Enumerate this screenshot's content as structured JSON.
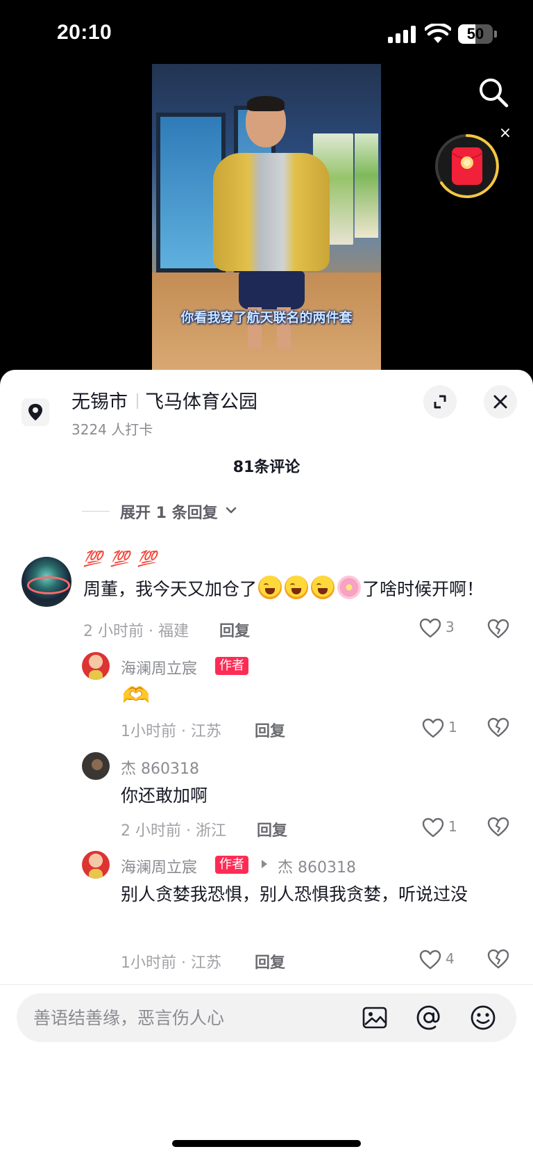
{
  "status_bar": {
    "time": "20:10",
    "battery": "50",
    "battery_level_percent": 50
  },
  "video": {
    "subtitle": "你看我穿了航天联名的两件套"
  },
  "location": {
    "city": "无锡市",
    "place": "飞马体育公园",
    "checkins": "3224 人打卡"
  },
  "comments_header": {
    "count_label": "81条评论"
  },
  "expand_replies": {
    "label": "展开 1 条回复"
  },
  "comments": [
    {
      "emoji_line": "💯 💯 💯",
      "text_before": "周董，我今天又加仓了",
      "text_after": "了啥时候开啊！",
      "meta": "2 小时前 · 福建",
      "reply_label": "回复",
      "likes": "3"
    }
  ],
  "replies": [
    {
      "author": "海澜周立宸",
      "badge": "作者",
      "text": "🫶",
      "meta": "1小时前 · 江苏",
      "reply_label": "回复",
      "likes": "1"
    },
    {
      "author": "杰 860318",
      "text": "你还敢加啊",
      "meta": "2 小时前 · 浙江",
      "reply_label": "回复",
      "likes": "1"
    },
    {
      "author": "海澜周立宸",
      "badge": "作者",
      "reply_to": "杰 860318",
      "text": "别人贪婪我恐惧，别人恐惧我贪婪，听说过没",
      "meta": "1小时前 · 江苏",
      "reply_label": "回复",
      "likes": "4"
    }
  ],
  "input": {
    "placeholder": "善语结善缘，恶言伤人心"
  },
  "colors": {
    "accent": "#fe2c55",
    "muted_text": "#8a8b91",
    "primary_text": "#161823",
    "emoji_red": "#e0281f"
  },
  "icons": {
    "search": "search-icon",
    "red_packet": "red-packet-icon",
    "location": "location-pin-icon",
    "expand": "expand-icon",
    "close": "close-icon",
    "like": "heart-icon",
    "dislike": "broken-heart-icon",
    "image": "image-icon",
    "mention": "at-icon",
    "emoji": "emoji-icon"
  }
}
